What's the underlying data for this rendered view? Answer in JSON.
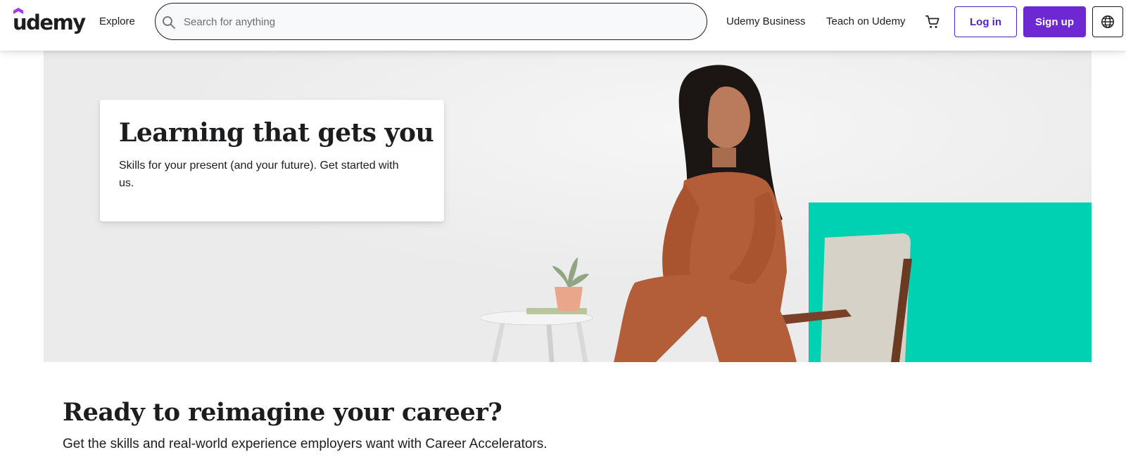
{
  "header": {
    "logo_text": "udemy",
    "explore_label": "Explore",
    "search": {
      "placeholder": "Search for anything",
      "value": ""
    },
    "business_link": "Udemy Business",
    "teach_link": "Teach on Udemy",
    "login_label": "Log in",
    "signup_label": "Sign up",
    "icons": {
      "search": "search-icon",
      "cart": "cart-icon",
      "language": "globe-icon"
    }
  },
  "hero": {
    "title": "Learning that gets you",
    "subtitle": "Skills for your present (and your future). Get started with us."
  },
  "section": {
    "title": "Ready to reimagine your career?",
    "subtitle": "Get the skills and real-world experience employers want with Career Accelerators."
  },
  "colors": {
    "brand_purple": "#6d28d2",
    "login_border": "#5022c3",
    "hero_bg": "#ebebeb",
    "accent_teal": "#00d1b2",
    "text": "#1c1d1f"
  }
}
